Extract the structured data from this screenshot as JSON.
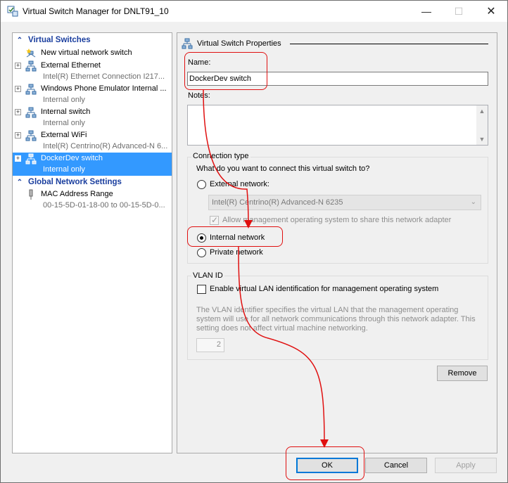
{
  "window": {
    "title": "Virtual Switch Manager for DNLT91_10",
    "minimize_glyph": "—",
    "maximize_glyph": "☐",
    "close_glyph": "✕"
  },
  "left": {
    "virtual_switches_header": "Virtual Switches",
    "global_header": "Global Network Settings",
    "items": [
      {
        "label": "New virtual network switch",
        "sub": "",
        "icon": "new-switch-icon"
      },
      {
        "label": "External Ethernet",
        "sub": "Intel(R) Ethernet Connection I217...",
        "icon": "network-switch-icon"
      },
      {
        "label": "Windows Phone Emulator Internal ...",
        "sub": "Internal only",
        "icon": "network-switch-icon"
      },
      {
        "label": "Internal switch",
        "sub": "Internal only",
        "icon": "network-switch-icon"
      },
      {
        "label": "External WiFi",
        "sub": "Intel(R) Centrino(R) Advanced-N 6...",
        "icon": "network-switch-icon"
      },
      {
        "label": "DockerDev switch",
        "sub": "Internal only",
        "icon": "network-switch-icon"
      }
    ],
    "global_items": [
      {
        "label": "MAC Address Range",
        "sub": "00-15-5D-01-18-00 to 00-15-5D-0...",
        "icon": "mac-address-icon"
      }
    ]
  },
  "properties": {
    "header": "Virtual Switch Properties",
    "name_label": "Name:",
    "name_value": "DockerDev switch",
    "notes_label": "Notes:",
    "notes_value": "",
    "connection_type": {
      "title": "Connection type",
      "question": "What do you want to connect this virtual switch to?",
      "external_label": "External network:",
      "external_adapter": "Intel(R) Centrino(R) Advanced-N 6235",
      "allow_mgmt_label": "Allow management operating system to share this network adapter",
      "internal_label": "Internal network",
      "private_label": "Private network",
      "selected": "internal"
    },
    "vlan": {
      "title": "VLAN ID",
      "enable_label": "Enable virtual LAN identification for management operating system",
      "description": "The VLAN identifier specifies the virtual LAN that the management operating system will use for all network communications through this network adapter. This setting does not affect virtual machine networking.",
      "value": "2"
    },
    "remove_label": "Remove"
  },
  "footer": {
    "ok_label": "OK",
    "cancel_label": "Cancel",
    "apply_label": "Apply"
  },
  "colors": {
    "selection": "#3399ff",
    "section_header": "#1a3e9e",
    "annotation": "#e01010",
    "default_button_border": "#0078d7"
  }
}
